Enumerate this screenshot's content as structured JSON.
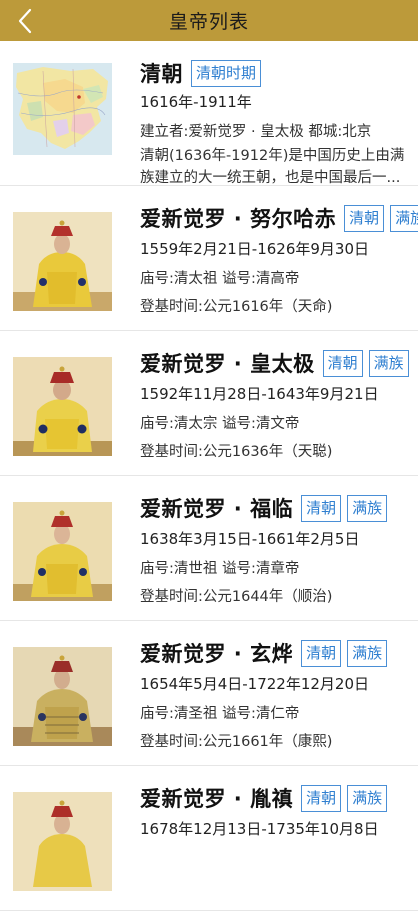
{
  "header": {
    "title": "皇帝列表"
  },
  "dynasty": {
    "name": "清朝",
    "tag": "清朝时期",
    "period": "1616年-1911年",
    "founder_line": "建立者:爱新觉罗 · 皇太极  都城:北京",
    "description": "清朝(1636年-1912年)是中国历史上由满族建立的大一统王朝，也是中国最后一..."
  },
  "emperors": [
    {
      "name": "爱新觉罗 · 努尔哈赤",
      "tags": [
        "清朝",
        "满族"
      ],
      "dates": "1559年2月21日-1626年9月30日",
      "titles": "庙号:清太祖 谥号:清高帝",
      "reign": "登基时间:公元1616年（天命)"
    },
    {
      "name": "爱新觉罗 · 皇太极",
      "tags": [
        "清朝",
        "满族"
      ],
      "dates": "1592年11月28日-1643年9月21日",
      "titles": "庙号:清太宗 谥号:清文帝",
      "reign": "登基时间:公元1636年（天聪)"
    },
    {
      "name": "爱新觉罗 · 福临",
      "tags": [
        "清朝",
        "满族"
      ],
      "dates": "1638年3月15日-1661年2月5日",
      "titles": "庙号:清世祖 谥号:清章帝",
      "reign": "登基时间:公元1644年（顺治)"
    },
    {
      "name": "爱新觉罗 · 玄烨",
      "tags": [
        "清朝",
        "满族"
      ],
      "dates": "1654年5月4日-1722年12月20日",
      "titles": "庙号:清圣祖 谥号:清仁帝",
      "reign": "登基时间:公元1661年（康熙)"
    },
    {
      "name": "爱新觉罗 · 胤禛",
      "tags": [
        "清朝",
        "满族"
      ],
      "dates": "1678年12月13日-1735年10月8日",
      "titles": "",
      "reign": ""
    }
  ],
  "colors": {
    "navbar": "#bc9a3a",
    "tag_border": "#4a8fd6",
    "tag_text": "#2f7fd0"
  },
  "icons": {
    "back": "chevron-left-icon"
  }
}
